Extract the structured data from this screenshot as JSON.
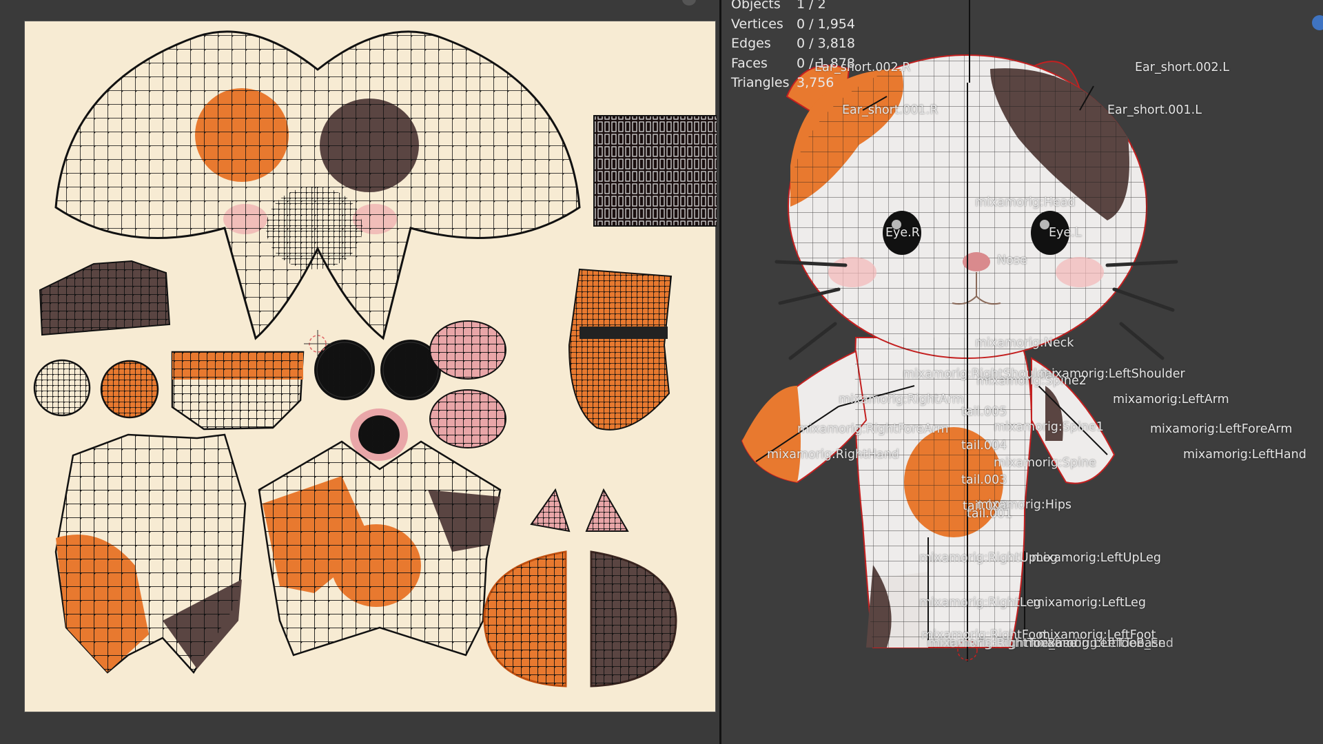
{
  "stats": [
    {
      "label": "Objects",
      "value": "1 / 2"
    },
    {
      "label": "Vertices",
      "value": "0 / 1,954"
    },
    {
      "label": "Edges",
      "value": "0 / 3,818"
    },
    {
      "label": "Faces",
      "value": "0 / 1,878"
    },
    {
      "label": "Triangles",
      "value": "3,756"
    }
  ],
  "bones": {
    "ear_short_002_r": "Ear_short.002.R",
    "ear_short_002_l": "Ear_short.002.L",
    "ear_short_001_r": "Ear_short.001.R",
    "ear_short_001_l": "Ear_short.001.L",
    "head": "mixamorig:Head",
    "eye_r": "Eye.R",
    "eye_l": "Eye.L",
    "nose": "Nose",
    "neck": "mixamorig:Neck",
    "right_shoulder": "mixamorig:RightShoulder",
    "left_shoulder": "mixamorig:LeftShoulder",
    "spine2": "mixamorig:Spine2",
    "right_arm": "mixamorig:RightArm",
    "left_arm": "mixamorig:LeftArm",
    "tail_005": "tail.005",
    "right_forearm": "mixamorig:RightForeArm",
    "spine1": "mixamorig:Spine1",
    "left_forearm": "mixamorig:LeftForeArm",
    "tail_004": "tail.004",
    "right_hand": "mixamorig:RightHand",
    "spine": "mixamorig:Spine",
    "left_hand": "mixamorig:LeftHand",
    "tail_003": "tail.003",
    "tail_002": "tail.002",
    "hips": "mixamorig:Hips",
    "tail_001": "tail.001",
    "right_upleg": "mixamorig:RightUpLeg",
    "left_upleg": "mixamorig:LeftUpLeg",
    "right_leg": "mixamorig:RightLeg",
    "left_leg": "mixamorig:LeftLeg",
    "right_foot": "mixamorig:RightFoot",
    "left_foot": "mixamorig:LeftFoot",
    "right_toebase": "mixamorig:RightToeBase",
    "left_toebase": "mixamorig:LeftToeBase",
    "right_toe_end": "mixamorig:RightToe_End",
    "left_toe_end": "mixamorig:LeftToe_End"
  },
  "colors": {
    "texture_bg": "#f7ebd3",
    "orange": "#e8792f",
    "brown": "#5a4542",
    "pink": "#e9a6a8",
    "mesh_white": "#f2f0ee",
    "viewport_bg": "#3d3d3d",
    "wire": "#111111",
    "selection_red": "#c42020"
  }
}
